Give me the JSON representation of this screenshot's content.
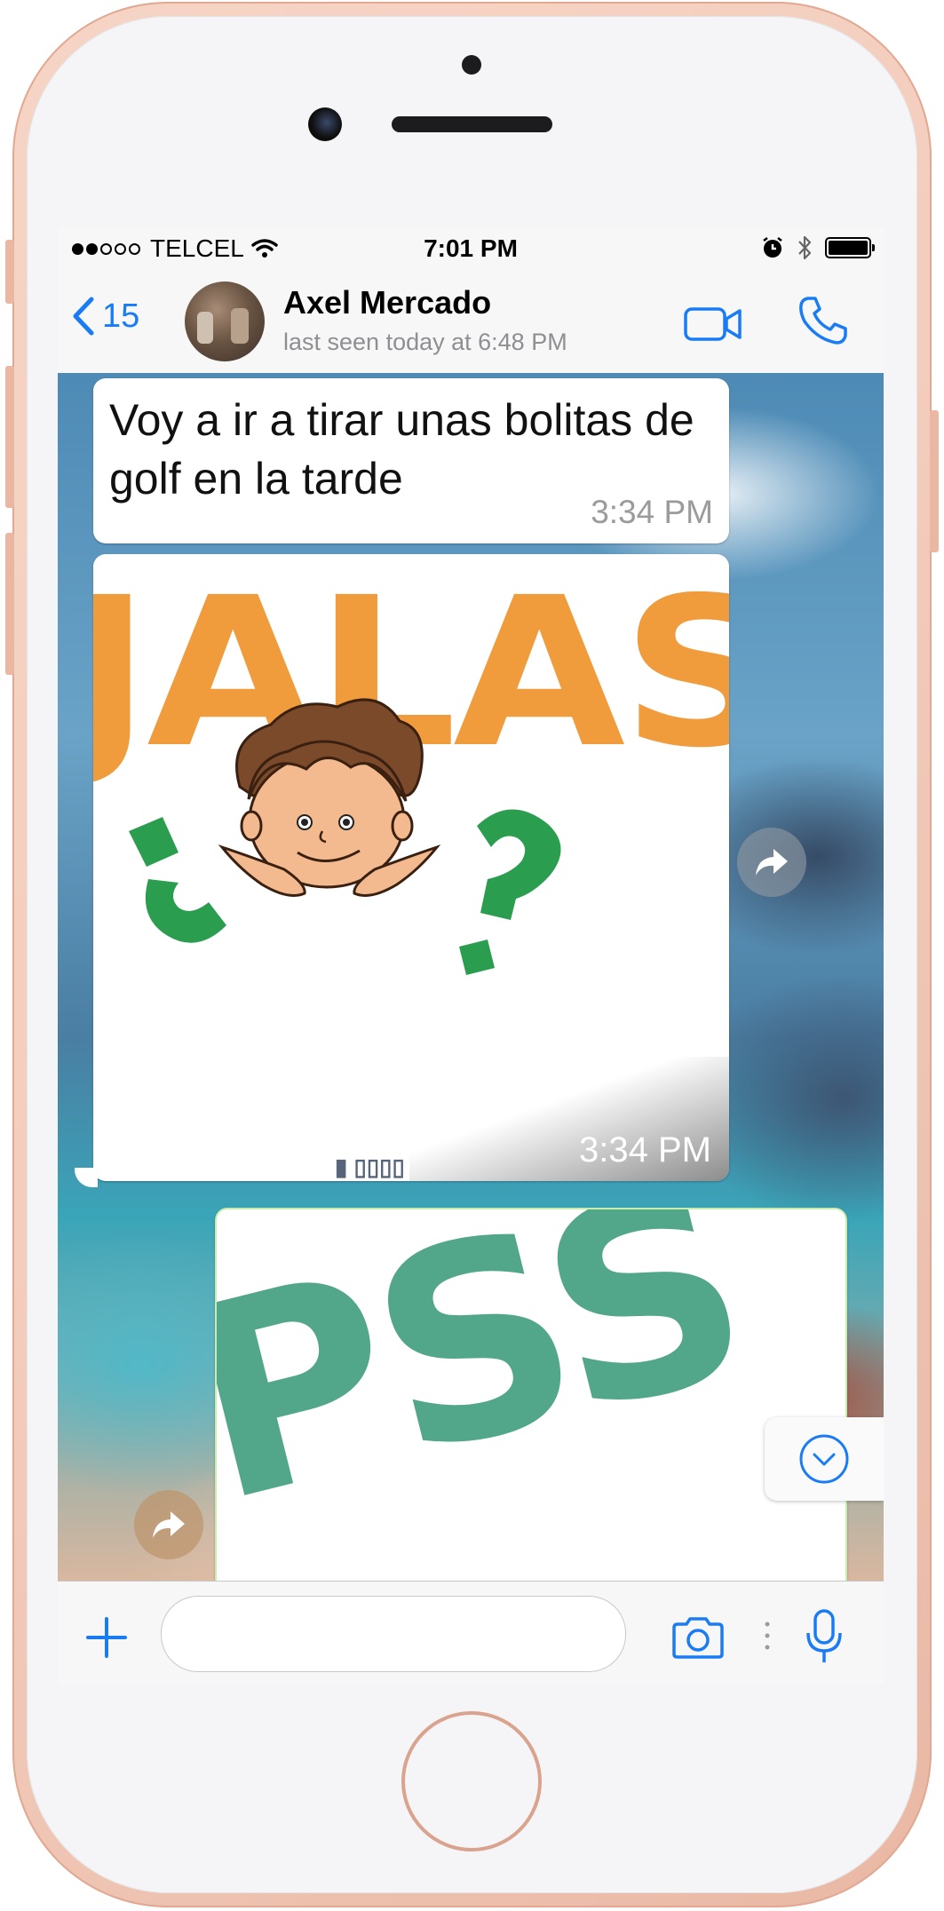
{
  "status_bar": {
    "carrier": "TELCEL",
    "time": "7:01 PM",
    "icons": [
      "signal-dots-icon",
      "wifi-icon",
      "alarm-icon",
      "bluetooth-icon",
      "battery-icon"
    ]
  },
  "header": {
    "back_count": "15",
    "contact_name": "Axel Mercado",
    "last_seen": "last seen today at 6:48 PM",
    "accent_color": "#1a7cf5"
  },
  "messages": [
    {
      "type": "text",
      "text": "Voy a ir a tirar unas bolitas de golf en la tarde",
      "time": "3:34 PM"
    },
    {
      "type": "image",
      "title": "JALAS",
      "time": "3:34 PM"
    },
    {
      "type": "image",
      "title": "PSS"
    }
  ],
  "input_bar": {
    "placeholder": "",
    "icons": [
      "plus-icon",
      "camera-icon",
      "microphone-icon"
    ]
  }
}
